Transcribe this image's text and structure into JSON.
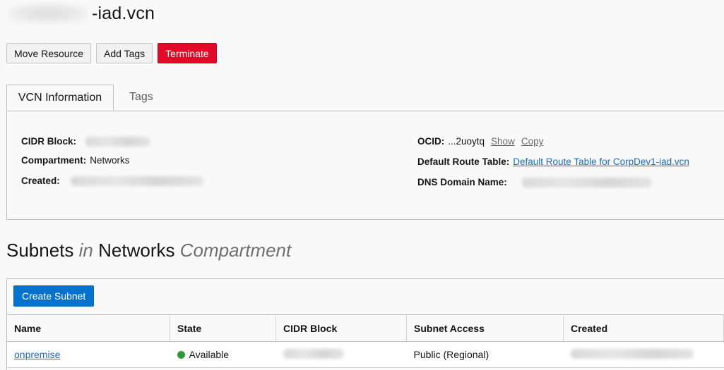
{
  "header": {
    "title_suffix": "-iad.vcn"
  },
  "actions": {
    "move_resource": "Move Resource",
    "add_tags": "Add Tags",
    "terminate": "Terminate"
  },
  "tabs": [
    {
      "label": "VCN Information"
    },
    {
      "label": "Tags"
    }
  ],
  "info": {
    "cidr_label": "CIDR Block:",
    "compartment_label": "Compartment:",
    "compartment_value": "Networks",
    "created_label": "Created:",
    "ocid_label": "OCID:",
    "ocid_value": "...2uoytq",
    "ocid_show": "Show",
    "ocid_copy": "Copy",
    "route_table_label": "Default Route Table:",
    "route_table_value": "Default Route Table for CorpDev1-iad.vcn",
    "dns_label": "DNS Domain Name:"
  },
  "subnets": {
    "heading_main": "Subnets",
    "heading_in": "in",
    "heading_compartment": "Networks",
    "heading_suffix": "Compartment",
    "create_button": "Create Subnet",
    "columns": [
      "Name",
      "State",
      "CIDR Block",
      "Subnet Access",
      "Created"
    ],
    "rows": [
      {
        "name": "onpremise",
        "state": "Available",
        "access": "Public (Regional)"
      }
    ]
  },
  "colors": {
    "danger": "#e10925",
    "primary": "#0572ce",
    "link": "#1a6bbf",
    "available": "#2c9a3b"
  }
}
